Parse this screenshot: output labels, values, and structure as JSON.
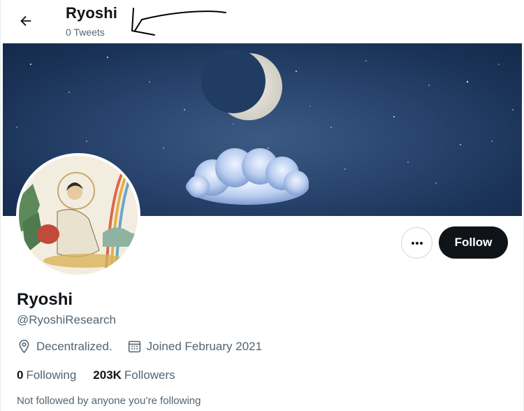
{
  "header": {
    "back_icon": "arrow-left-icon",
    "title": "Ryoshi",
    "subtitle": "0 Tweets"
  },
  "banner": {
    "description_icons": [
      "moon",
      "stars",
      "cloud"
    ]
  },
  "actions": {
    "more_icon": "ellipsis-icon",
    "follow_label": "Follow"
  },
  "profile": {
    "name": "Ryoshi",
    "handle": "@RyoshiResearch",
    "location_icon": "location-pin-icon",
    "location": "Decentralized.",
    "joined_icon": "calendar-icon",
    "joined": "Joined February 2021",
    "following_count": "0",
    "following_label": "Following",
    "followers_count": "203K",
    "followers_label": "Followers",
    "not_followed": "Not followed by anyone you’re following"
  },
  "colors": {
    "text_primary": "#0f1419",
    "text_secondary": "#536471",
    "follow_bg": "#0f1419",
    "follow_text": "#ffffff",
    "banner_sky": "#1b3358"
  }
}
